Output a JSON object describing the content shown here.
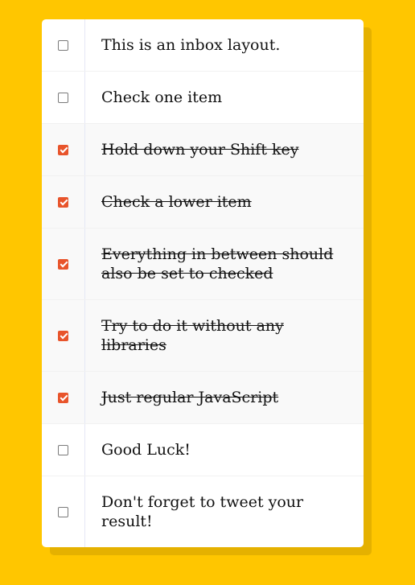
{
  "colors": {
    "background": "#ffc600",
    "checkbox_checked": "#e8542b"
  },
  "inbox": {
    "items": [
      {
        "label": "This is an inbox layout.",
        "checked": false
      },
      {
        "label": "Check one item",
        "checked": false
      },
      {
        "label": "Hold down your Shift key",
        "checked": true
      },
      {
        "label": "Check a lower item",
        "checked": true
      },
      {
        "label": "Everything in between should also be set to checked",
        "checked": true
      },
      {
        "label": "Try to do it without any libraries",
        "checked": true
      },
      {
        "label": "Just regular JavaScript",
        "checked": true
      },
      {
        "label": "Good Luck!",
        "checked": false
      },
      {
        "label": "Don't forget to tweet your result!",
        "checked": false
      }
    ]
  }
}
